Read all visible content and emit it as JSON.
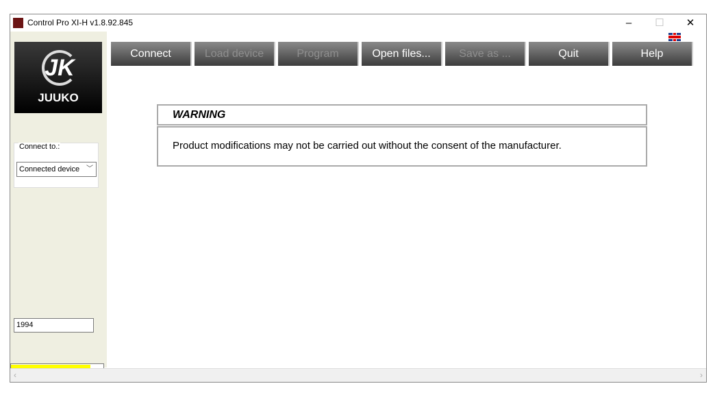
{
  "window": {
    "title": "Control Pro XI-H v1.8.92.845",
    "icon": "app-icon",
    "minimize": "–",
    "maximize": "☐",
    "close": "✕"
  },
  "sidebar": {
    "logo": {
      "mark": "JK",
      "name": "JUUKO"
    },
    "connect_group": {
      "legend": "Connect to.:",
      "selected": "Connected device"
    },
    "year_value": "1994",
    "bottom_select": {
      "selected": "- - - - - - - - - -",
      "highlight_color": "#ffff00"
    }
  },
  "language_flag": "uk-flag-icon",
  "toolbar": [
    {
      "label": "Connect",
      "enabled": true
    },
    {
      "label": "Load device",
      "enabled": false
    },
    {
      "label": "Program",
      "enabled": false
    },
    {
      "label": "Open files...",
      "enabled": true
    },
    {
      "label": "Save as ...",
      "enabled": false
    },
    {
      "label": "Quit",
      "enabled": true
    },
    {
      "label": "Help",
      "enabled": true
    }
  ],
  "warning": {
    "title": "WARNING",
    "message": "Product modifications may not be carried out without the consent of the manufacturer."
  },
  "scrollbar": {
    "left": "‹",
    "right": "›"
  }
}
